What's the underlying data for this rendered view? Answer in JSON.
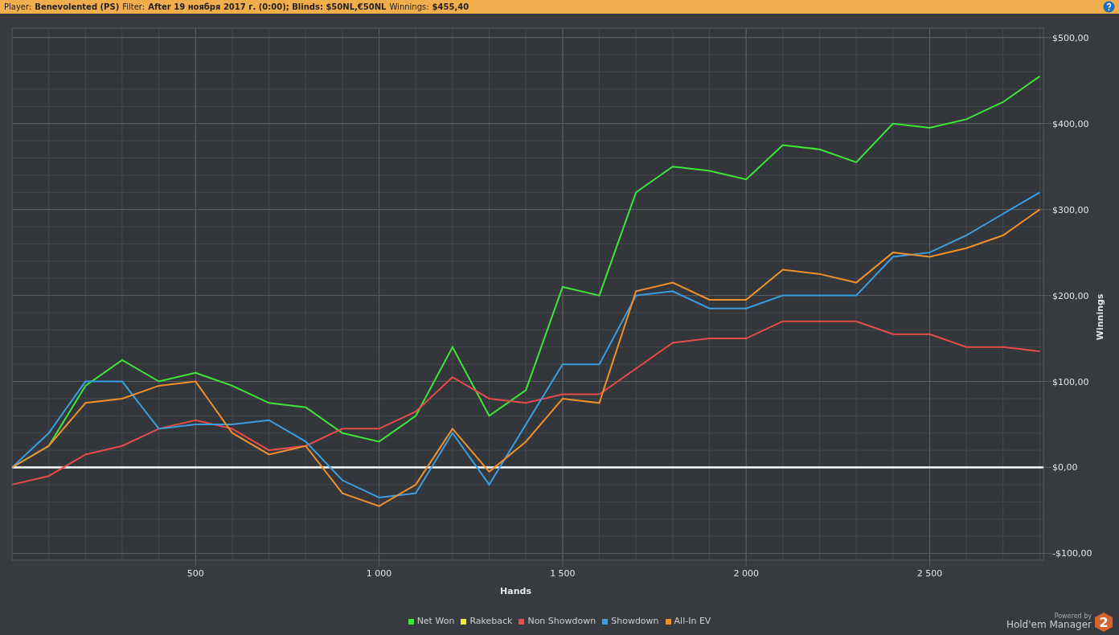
{
  "header": {
    "fields": [
      {
        "label": "Player:",
        "value": "Benevolented (PS)"
      },
      {
        "label": "Filter:",
        "value": "After 19 ноября 2017 г. (0:00); Blinds: $50NL,€50NL"
      },
      {
        "label": "Winnings:",
        "value": "$455,40"
      }
    ]
  },
  "chart": {
    "chart_data": {
      "type": "line",
      "xlabel": "Hands",
      "ylabel": "Winnings",
      "x": [
        0,
        100,
        200,
        300,
        400,
        500,
        600,
        700,
        800,
        900,
        1000,
        1100,
        1200,
        1300,
        1400,
        1500,
        1600,
        1700,
        1800,
        1900,
        2000,
        2100,
        2200,
        2300,
        2400,
        2500,
        2600,
        2700,
        2800
      ],
      "series": [
        {
          "name": "Net Won",
          "color": "#3ee63a",
          "values": [
            0,
            25,
            95,
            125,
            100,
            110,
            95,
            75,
            70,
            40,
            30,
            60,
            140,
            60,
            90,
            210,
            200,
            320,
            350,
            345,
            335,
            375,
            370,
            355,
            400,
            395,
            405,
            425,
            455
          ]
        },
        {
          "name": "Rakeback",
          "color": "#f2ea3a",
          "values": [
            null,
            null,
            null,
            null,
            null,
            null,
            null,
            null,
            null,
            null,
            null,
            null,
            null,
            null,
            null,
            null,
            null,
            null,
            null,
            null,
            null,
            null,
            null,
            null,
            null,
            null,
            null,
            null,
            null
          ]
        },
        {
          "name": "Non Showdown",
          "color": "#e84b4b",
          "values": [
            -20,
            -10,
            15,
            25,
            45,
            55,
            45,
            20,
            25,
            45,
            45,
            65,
            105,
            80,
            75,
            85,
            85,
            115,
            145,
            150,
            150,
            170,
            170,
            170,
            155,
            155,
            140,
            140,
            135
          ]
        },
        {
          "name": "Showdown",
          "color": "#3a9ee0",
          "values": [
            0,
            40,
            100,
            100,
            45,
            50,
            50,
            55,
            30,
            -15,
            -35,
            -30,
            40,
            -20,
            50,
            120,
            120,
            200,
            205,
            185,
            185,
            200,
            200,
            200,
            245,
            250,
            270,
            295,
            320
          ]
        },
        {
          "name": "All-In EV",
          "color": "#f0912e",
          "values": [
            0,
            25,
            75,
            80,
            95,
            100,
            40,
            15,
            25,
            -30,
            -45,
            -20,
            45,
            -5,
            30,
            80,
            75,
            205,
            215,
            195,
            195,
            230,
            225,
            215,
            250,
            245,
            255,
            270,
            300
          ]
        }
      ],
      "xlim": [
        0,
        2810
      ],
      "ylim": [
        -108,
        511
      ],
      "xticks": [
        {
          "value": 500,
          "label": "500"
        },
        {
          "value": 1000,
          "label": "1 000"
        },
        {
          "value": 1500,
          "label": "1 500"
        },
        {
          "value": 2000,
          "label": "2 000"
        },
        {
          "value": 2500,
          "label": "2 500"
        }
      ],
      "yticks": [
        {
          "value": -100,
          "label": "-$100,00"
        },
        {
          "value": 0,
          "label": "$0,00"
        },
        {
          "value": 100,
          "label": "$100,00"
        },
        {
          "value": 200,
          "label": "$200,00"
        },
        {
          "value": 300,
          "label": "$300,00"
        },
        {
          "value": 400,
          "label": "$400,00"
        },
        {
          "value": 500,
          "label": "$500,00"
        }
      ],
      "grid": true,
      "ref_lines": [
        {
          "axis": "y",
          "value": 0
        }
      ]
    }
  },
  "footer": {
    "powered_by": "Powered by",
    "product": "Hold'em Manager",
    "badge": "2"
  }
}
